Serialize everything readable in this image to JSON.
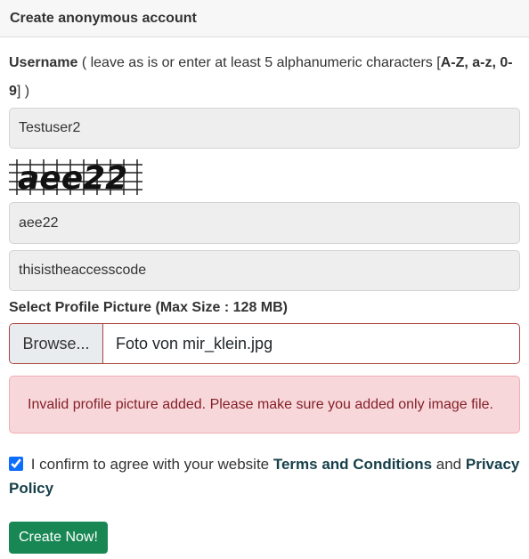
{
  "header": {
    "title": "Create anonymous account"
  },
  "username": {
    "label": "Username",
    "hint_pre": " ( leave as is or enter at least 5 alphanumeric characters [",
    "hint_bold": "A-Z, a-z, 0-9",
    "hint_post": "] )",
    "value": "Testuser2"
  },
  "captcha": {
    "image_text": "aee22",
    "value": "aee22"
  },
  "access_code": {
    "value": "thisistheaccesscode"
  },
  "profile_picture": {
    "label": "Select Profile Picture (Max Size : 128 MB)",
    "browse_label": "Browse...",
    "file_name": "Foto von mir_klein.jpg"
  },
  "error": {
    "message": "Invalid profile picture added. Please make sure you added only image file."
  },
  "consent": {
    "checked": true,
    "text_pre": " I confirm to agree with your website ",
    "terms": "Terms and Conditions",
    "and": " and ",
    "privacy": "Privacy Policy"
  },
  "submit": {
    "label": "Create Now!"
  }
}
